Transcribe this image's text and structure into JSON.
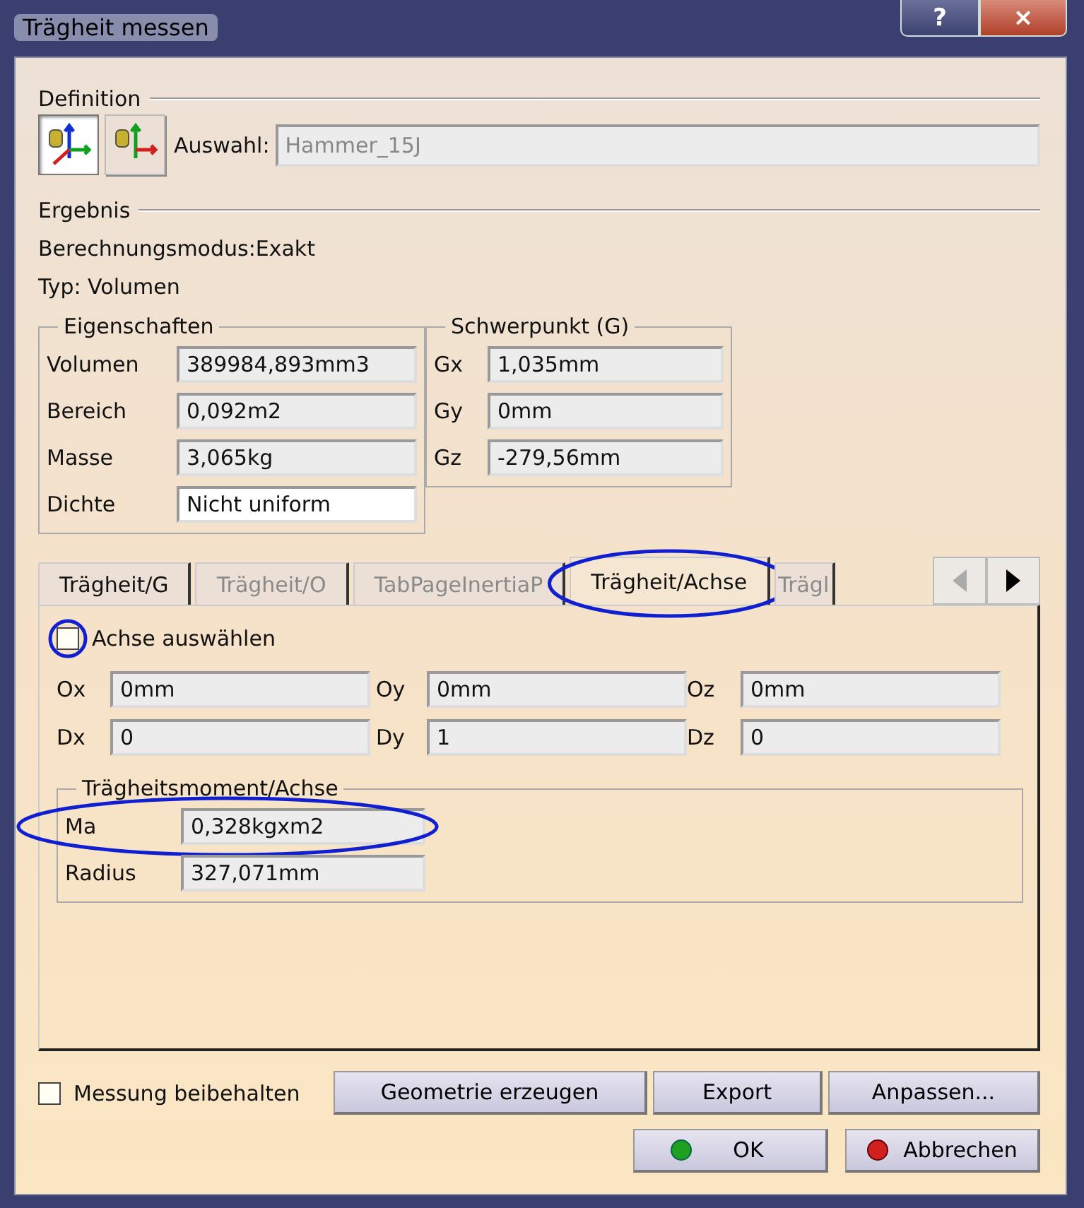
{
  "window": {
    "title": "Trägheit messen",
    "help": "?",
    "close": "×"
  },
  "definition": {
    "label": "Definition",
    "mode_buttons": [
      {
        "selected": true
      },
      {
        "selected": false
      }
    ],
    "selection_label": "Auswahl:",
    "selection_value": "Hammer_15J"
  },
  "result": {
    "label": "Ergebnis",
    "mode": "Berechnungsmodus:Exakt",
    "type": "Typ: Volumen"
  },
  "properties": {
    "title": "Eigenschaften",
    "rows": [
      {
        "label": "Volumen",
        "value": "389984,893mm3",
        "kind": "readonly"
      },
      {
        "label": "Bereich",
        "value": "0,092m2",
        "kind": "readonly"
      },
      {
        "label": "Masse",
        "value": "3,065kg",
        "kind": "readonly"
      },
      {
        "label": "Dichte",
        "value": "Nicht uniform",
        "kind": "editable"
      }
    ]
  },
  "centroid": {
    "title": "Schwerpunkt (G)",
    "rows": [
      {
        "label": "Gx",
        "value": "1,035mm"
      },
      {
        "label": "Gy",
        "value": "0mm"
      },
      {
        "label": "Gz",
        "value": "-279,56mm"
      }
    ]
  },
  "tabs": [
    {
      "label": "Trägheit/G",
      "selected": false,
      "disabled": false
    },
    {
      "label": "Trägheit/O",
      "selected": false,
      "disabled": true
    },
    {
      "label": "TabPageInertiaP",
      "selected": false,
      "disabled": true
    },
    {
      "label": "Trägheit/Achse",
      "selected": true,
      "disabled": false
    },
    {
      "label": "Trägl",
      "selected": false,
      "disabled": true
    }
  ],
  "axis": {
    "select_axis": {
      "label": "Achse auswählen",
      "checked": false
    },
    "fields": [
      {
        "label": "Ox",
        "value": "0mm"
      },
      {
        "label": "Oy",
        "value": "0mm"
      },
      {
        "label": "Oz",
        "value": "0mm"
      },
      {
        "label": "Dx",
        "value": "0"
      },
      {
        "label": "Dy",
        "value": "1"
      },
      {
        "label": "Dz",
        "value": "0"
      }
    ]
  },
  "moment": {
    "title": "Trägheitsmoment/Achse",
    "rows": [
      {
        "label": "Ma",
        "value": "0,328kgxm2"
      },
      {
        "label": "Radius",
        "value": "327,071mm"
      }
    ]
  },
  "footer": {
    "keep": {
      "label": "Messung beibehalten",
      "checked": false
    },
    "buttons": [
      "Geometrie erzeugen",
      "Export",
      "Anpassen..."
    ],
    "ok": "OK",
    "cancel": "Abbrechen"
  }
}
